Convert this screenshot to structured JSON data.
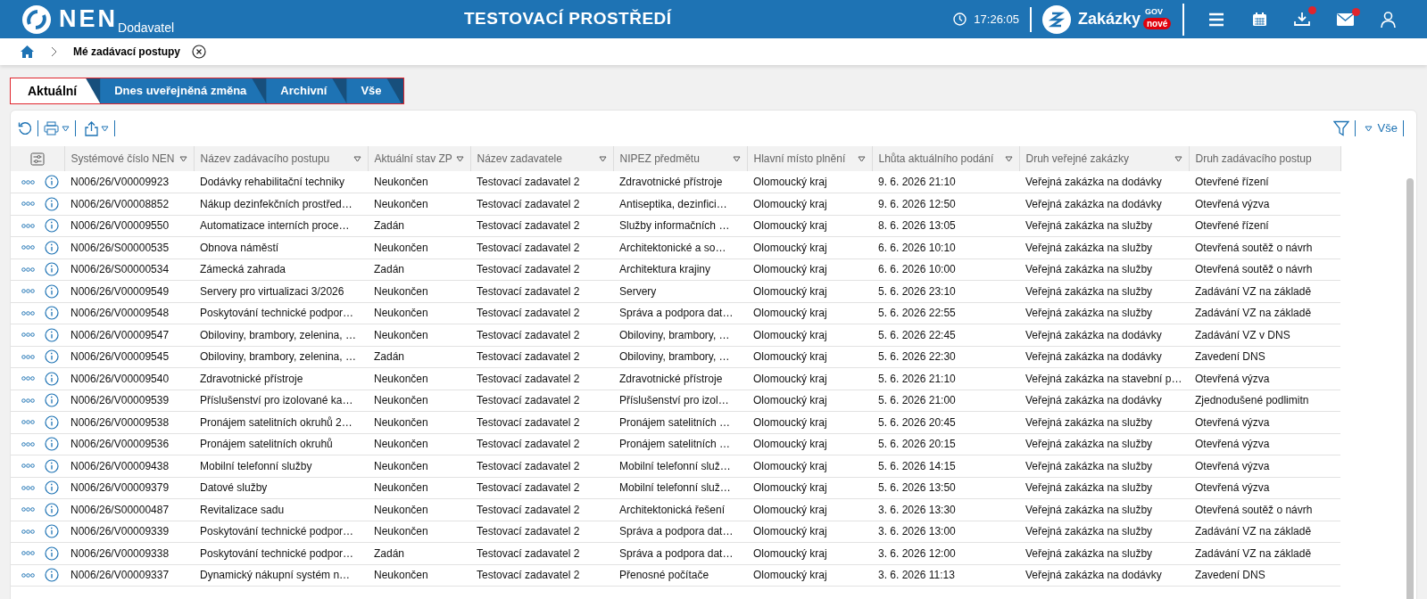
{
  "header": {
    "logo_text": "NEN",
    "logo_sub": "Dodavatel",
    "environment": "TESTOVACÍ PROSTŘEDÍ",
    "time": "17:26:05",
    "brand": "Zakázky",
    "brand_sup": "GOV",
    "brand_badge": "nové",
    "nav_icons": [
      {
        "kind": "menu",
        "dot": false
      },
      {
        "kind": "calendar",
        "dot": false
      },
      {
        "kind": "download",
        "dot": true
      },
      {
        "kind": "mail",
        "dot": true
      },
      {
        "kind": "user",
        "dot": false
      }
    ]
  },
  "breadcrumb": {
    "current": "Mé zadávací postupy"
  },
  "tabs": [
    {
      "label": "Aktuální",
      "selected": true
    },
    {
      "label": "Dnes uveřejněná změna",
      "selected": false
    },
    {
      "label": "Archivní",
      "selected": false
    },
    {
      "label": "Vše",
      "selected": false
    }
  ],
  "toolbar": {
    "filter_label": "Vše"
  },
  "table": {
    "columns": [
      "Systémové číslo NEN",
      "Název zadávacího postupu",
      "Aktuální stav ZP",
      "Název zadavatele",
      "NIPEZ předmětu",
      "Hlavní místo plnění",
      "Lhůta aktuálního podání",
      "Druh veřejné zakázky",
      "Druh zadávacího postup"
    ],
    "rows": [
      [
        "N006/26/V00009923",
        "Dodávky rehabilitační techniky",
        "Neukončen",
        "Testovací zadavatel 2",
        "Zdravotnické přístroje",
        "Olomoucký kraj",
        "9. 6. 2026 21:10",
        "Veřejná zakázka na dodávky",
        "Otevřené řízení"
      ],
      [
        "N006/26/V00008852",
        "Nákup dezinfekčních prostřed…",
        "Neukončen",
        "Testovací zadavatel 2",
        "Antiseptika, dezinfici…",
        "Olomoucký kraj",
        "9. 6. 2026 12:50",
        "Veřejná zakázka na dodávky",
        "Otevřená výzva"
      ],
      [
        "N006/26/V00009550",
        "Automatizace interních proce…",
        "Zadán",
        "Testovací zadavatel 2",
        "Služby informačních …",
        "Olomoucký kraj",
        "8. 6. 2026 13:05",
        "Veřejná zakázka na služby",
        "Otevřené řízení"
      ],
      [
        "N006/26/S00000535",
        "Obnova náměstí",
        "Neukončen",
        "Testovací zadavatel 2",
        "Architektonické a so…",
        "Olomoucký kraj",
        "6. 6. 2026 10:10",
        "Veřejná zakázka na služby",
        "Otevřená soutěž o návrh"
      ],
      [
        "N006/26/S00000534",
        "Zámecká zahrada",
        "Zadán",
        "Testovací zadavatel 2",
        "Architektura krajiny",
        "Olomoucký kraj",
        "6. 6. 2026 10:00",
        "Veřejná zakázka na služby",
        "Otevřená soutěž o návrh"
      ],
      [
        "N006/26/V00009549",
        "Servery pro virtualizaci 3/2026",
        "Neukončen",
        "Testovací zadavatel 2",
        "Servery",
        "Olomoucký kraj",
        "5. 6. 2026 23:10",
        "Veřejná zakázka na služby",
        "Zadávání VZ na základě"
      ],
      [
        "N006/26/V00009548",
        "Poskytování technické podpor…",
        "Neukončen",
        "Testovací zadavatel 2",
        "Správa a podpora dat…",
        "Olomoucký kraj",
        "5. 6. 2026 22:55",
        "Veřejná zakázka na služby",
        "Zadávání VZ na základě"
      ],
      [
        "N006/26/V00009547",
        "Obiloviny, brambory, zelenina, …",
        "Neukončen",
        "Testovací zadavatel 2",
        "Obiloviny, brambory, …",
        "Olomoucký kraj",
        "5. 6. 2026 22:45",
        "Veřejná zakázka na dodávky",
        "Zadávání VZ v DNS"
      ],
      [
        "N006/26/V00009545",
        "Obiloviny, brambory, zelenina, …",
        "Zadán",
        "Testovací zadavatel 2",
        "Obiloviny, brambory, …",
        "Olomoucký kraj",
        "5. 6. 2026 22:30",
        "Veřejná zakázka na dodávky",
        "Zavedení DNS"
      ],
      [
        "N006/26/V00009540",
        "Zdravotnické přístroje",
        "Neukončen",
        "Testovací zadavatel 2",
        "Zdravotnické přístroje",
        "Olomoucký kraj",
        "5. 6. 2026 21:10",
        "Veřejná zakázka na stavební p…",
        "Otevřená výzva"
      ],
      [
        "N006/26/V00009539",
        "Příslušenství pro izolované ka…",
        "Neukončen",
        "Testovací zadavatel 2",
        "Příslušenství pro izol…",
        "Olomoucký kraj",
        "5. 6. 2026 21:00",
        "Veřejná zakázka na dodávky",
        "Zjednodušené podlimitn"
      ],
      [
        "N006/26/V00009538",
        "Pronájem satelitních okruhů 2…",
        "Neukončen",
        "Testovací zadavatel 2",
        "Pronájem satelitních …",
        "Olomoucký kraj",
        "5. 6. 2026 20:45",
        "Veřejná zakázka na služby",
        "Otevřená výzva"
      ],
      [
        "N006/26/V00009536",
        "Pronájem satelitních okruhů",
        "Neukončen",
        "Testovací zadavatel 2",
        "Pronájem satelitních …",
        "Olomoucký kraj",
        "5. 6. 2026 20:15",
        "Veřejná zakázka na služby",
        "Otevřená výzva"
      ],
      [
        "N006/26/V00009438",
        "Mobilní telefonní služby",
        "Neukončen",
        "Testovací zadavatel 2",
        "Mobilní telefonní služ…",
        "Olomoucký kraj",
        "5. 6. 2026 14:15",
        "Veřejná zakázka na služby",
        "Otevřená výzva"
      ],
      [
        "N006/26/V00009379",
        "Datové služby",
        "Neukončen",
        "Testovací zadavatel 2",
        "Mobilní telefonní služ…",
        "Olomoucký kraj",
        "5. 6. 2026 13:50",
        "Veřejná zakázka na služby",
        "Otevřená výzva"
      ],
      [
        "N006/26/S00000487",
        "Revitalizace sadu",
        "Neukončen",
        "Testovací zadavatel 2",
        "Architektonická řešení",
        "Olomoucký kraj",
        "3. 6. 2026 13:30",
        "Veřejná zakázka na služby",
        "Otevřená soutěž o návrh"
      ],
      [
        "N006/26/V00009339",
        "Poskytování technické podpor…",
        "Neukončen",
        "Testovací zadavatel 2",
        "Správa a podpora dat…",
        "Olomoucký kraj",
        "3. 6. 2026 13:00",
        "Veřejná zakázka na služby",
        "Zadávání VZ na základě"
      ],
      [
        "N006/26/V00009338",
        "Poskytování technické podpor…",
        "Zadán",
        "Testovací zadavatel 2",
        "Správa a podpora dat…",
        "Olomoucký kraj",
        "3. 6. 2026 12:00",
        "Veřejná zakázka na služby",
        "Zadávání VZ na základě"
      ],
      [
        "N006/26/V00009337",
        "Dynamický nákupní systém n…",
        "Neukončen",
        "Testovací zadavatel 2",
        "Přenosné počítače",
        "Olomoucký kraj",
        "3. 6. 2026 11:13",
        "Veřejná zakázka na dodávky",
        "Zavedení DNS"
      ]
    ]
  }
}
